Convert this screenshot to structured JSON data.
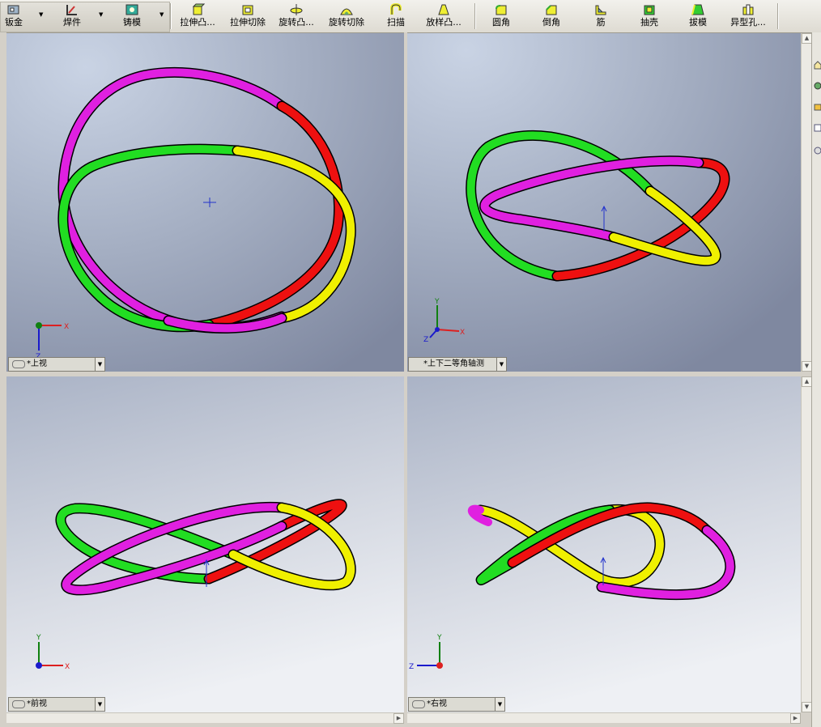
{
  "toolbar": {
    "buttons": [
      {
        "label": "钣金",
        "icon": "sheet-metal-icon"
      },
      {
        "label": "焊件",
        "icon": "weldment-icon"
      },
      {
        "label": "铸模",
        "icon": "mold-icon"
      },
      {
        "label": "拉伸凸...",
        "icon": "extrude-boss-icon"
      },
      {
        "label": "拉伸切除",
        "icon": "extrude-cut-icon"
      },
      {
        "label": "旋转凸...",
        "icon": "revolve-boss-icon"
      },
      {
        "label": "旋转切除",
        "icon": "revolve-cut-icon"
      },
      {
        "label": "扫描",
        "icon": "sweep-icon"
      },
      {
        "label": "放样凸...",
        "icon": "loft-icon"
      },
      {
        "label": "圆角",
        "icon": "fillet-icon"
      },
      {
        "label": "倒角",
        "icon": "chamfer-icon"
      },
      {
        "label": "筋",
        "icon": "rib-icon"
      },
      {
        "label": "抽壳",
        "icon": "shell-icon"
      },
      {
        "label": "拔模",
        "icon": "draft-icon"
      },
      {
        "label": "异型孔...",
        "icon": "hole-wizard-icon"
      }
    ]
  },
  "viewports": {
    "top": {
      "label": "*上视",
      "axes": [
        "X",
        "Z"
      ]
    },
    "iso": {
      "label": "*上下二等角轴测",
      "axes": [
        "Y",
        "X",
        "Z"
      ]
    },
    "front": {
      "label": "*前视",
      "axes": [
        "Y",
        "X"
      ]
    },
    "right": {
      "label": "*右视",
      "axes": [
        "Y",
        "Z"
      ]
    }
  },
  "colors": {
    "magenta": "#e020e0",
    "red": "#ee1010",
    "yellow": "#f0f000",
    "green": "#22dd22",
    "axis_red": "#dd2020",
    "axis_green": "#108010",
    "axis_blue": "#1a1acc"
  }
}
